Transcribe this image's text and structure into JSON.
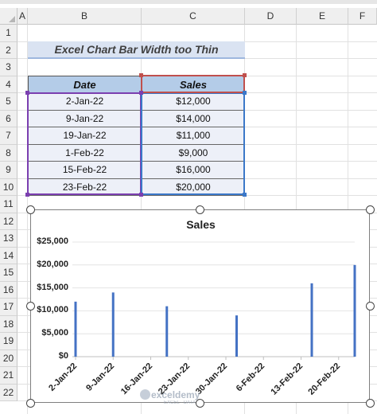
{
  "sheet": {
    "columns": [
      "A",
      "B",
      "C",
      "D",
      "E",
      "F"
    ],
    "rows": [
      "1",
      "2",
      "3",
      "4",
      "5",
      "6",
      "7",
      "8",
      "9",
      "10",
      "11",
      "12",
      "13",
      "14",
      "15",
      "16",
      "17",
      "18",
      "19",
      "20",
      "21",
      "22"
    ]
  },
  "title": "Excel Chart Bar Width too Thin",
  "table": {
    "headers": {
      "date": "Date",
      "sales": "Sales"
    },
    "rows": [
      {
        "date": "2-Jan-22",
        "sales": "$12,000"
      },
      {
        "date": "9-Jan-22",
        "sales": "$14,000"
      },
      {
        "date": "19-Jan-22",
        "sales": "$11,000"
      },
      {
        "date": "1-Feb-22",
        "sales": "$9,000"
      },
      {
        "date": "15-Feb-22",
        "sales": "$16,000"
      },
      {
        "date": "23-Feb-22",
        "sales": "$20,000"
      }
    ]
  },
  "chart_data": {
    "type": "bar",
    "title": "Sales",
    "x": [
      "2022-01-02",
      "2022-01-09",
      "2022-01-19",
      "2022-02-01",
      "2022-02-15",
      "2022-02-23"
    ],
    "values": [
      12000,
      14000,
      11000,
      9000,
      16000,
      20000
    ],
    "xlabel": "",
    "ylabel": "",
    "xtick_labels": [
      "2-Jan-22",
      "9-Jan-22",
      "16-Jan-22",
      "23-Jan-22",
      "30-Jan-22",
      "6-Feb-22",
      "13-Feb-22",
      "20-Feb-22"
    ],
    "xlim": [
      "2022-01-02",
      "2022-02-23"
    ],
    "ylim": [
      0,
      25000
    ],
    "ytick_labels": [
      "$0",
      "$5,000",
      "$10,000",
      "$15,000",
      "$20,000",
      "$25,000"
    ],
    "grid": true,
    "bar_color": "#4472c4"
  },
  "watermark": {
    "name": "exceldemy",
    "tagline": "EXCEL · DATA · BI"
  },
  "colors": {
    "title_fill": "#dae3f2",
    "header_fill": "#b4cce8",
    "cell_fill": "#edf0f8",
    "bar": "#4472c4"
  }
}
